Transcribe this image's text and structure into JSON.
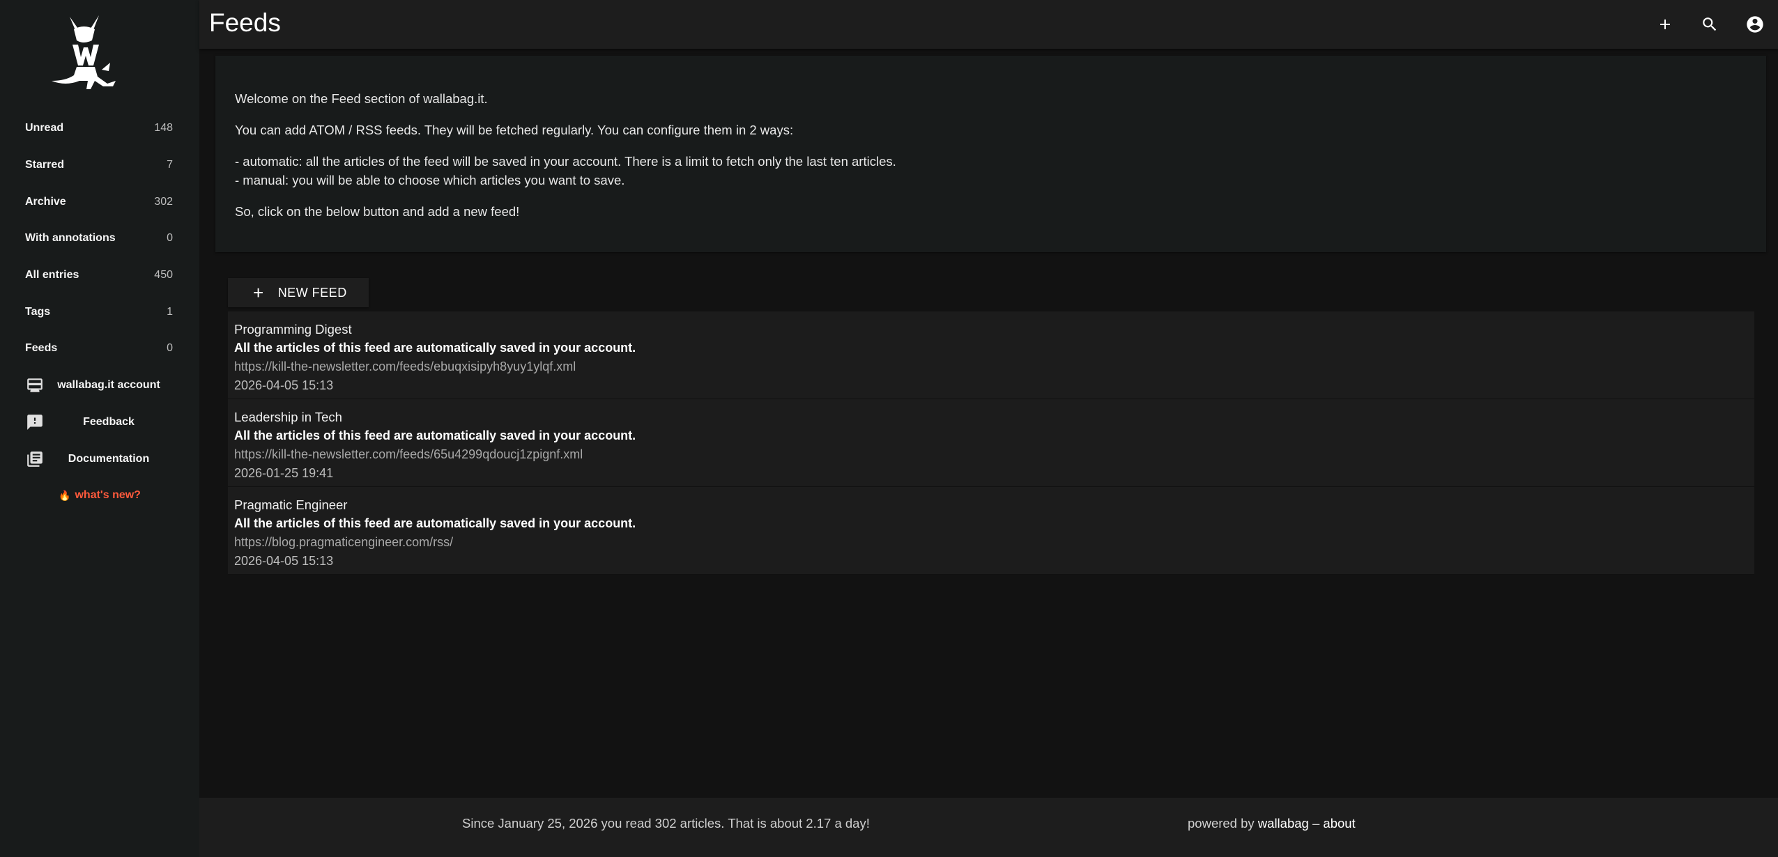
{
  "header": {
    "title": "Feeds",
    "add_icon": "plus-icon",
    "search_icon": "search-icon",
    "account_icon": "account-circle-icon"
  },
  "sidebar": {
    "logo": "wallabag-logo",
    "counters": [
      {
        "label": "Unread",
        "count": "148"
      },
      {
        "label": "Starred",
        "count": "7"
      },
      {
        "label": "Archive",
        "count": "302"
      },
      {
        "label": "With annotations",
        "count": "0"
      },
      {
        "label": "All entries",
        "count": "450"
      },
      {
        "label": "Tags",
        "count": "1"
      },
      {
        "label": "Feeds",
        "count": "0"
      }
    ],
    "links": [
      {
        "label": "wallabag.it account",
        "icon": "credit-card-icon"
      },
      {
        "label": "Feedback",
        "icon": "feedback-icon"
      },
      {
        "label": "Documentation",
        "icon": "library-books-icon"
      }
    ],
    "whats_new": "what's new?"
  },
  "info": {
    "line1": "Welcome on the Feed section of wallabag.it.",
    "line2": "You can add ATOM / RSS feeds. They will be fetched regularly. You can configure them in 2 ways:",
    "line3": "- automatic: all the articles of the feed will be saved in your account. There is a limit to fetch only the last ten articles.",
    "line4": "- manual: you will be able to choose which articles you want to save.",
    "line5": "So, click on the below button and add a new feed!"
  },
  "new_feed_label": "NEW FEED",
  "feeds": [
    {
      "title": "Programming Digest",
      "desc": "All the articles of this feed are automatically saved in your account.",
      "url": "https://kill-the-newsletter.com/feeds/ebuqxisipyh8yuy1ylqf.xml",
      "date": "2026-04-05 15:13"
    },
    {
      "title": "Leadership in Tech",
      "desc": "All the articles of this feed are automatically saved in your account.",
      "url": "https://kill-the-newsletter.com/feeds/65u4299qdoucj1zpignf.xml",
      "date": "2026-01-25 19:41"
    },
    {
      "title": "Pragmatic Engineer",
      "desc": "All the articles of this feed are automatically saved in your account.",
      "url": "https://blog.pragmaticengineer.com/rss/",
      "date": "2026-04-05 15:13"
    }
  ],
  "footer": {
    "stats": "Since January 25, 2026 you read 302 articles. That is about 2.17 a day!",
    "powered_by": "powered by",
    "wallabag_link": "wallabag",
    "dash": "–",
    "about_link": "about"
  },
  "colors": {
    "background": "#121212",
    "sidebar": "#181b1b",
    "whats_new": "#ff5a3c"
  }
}
